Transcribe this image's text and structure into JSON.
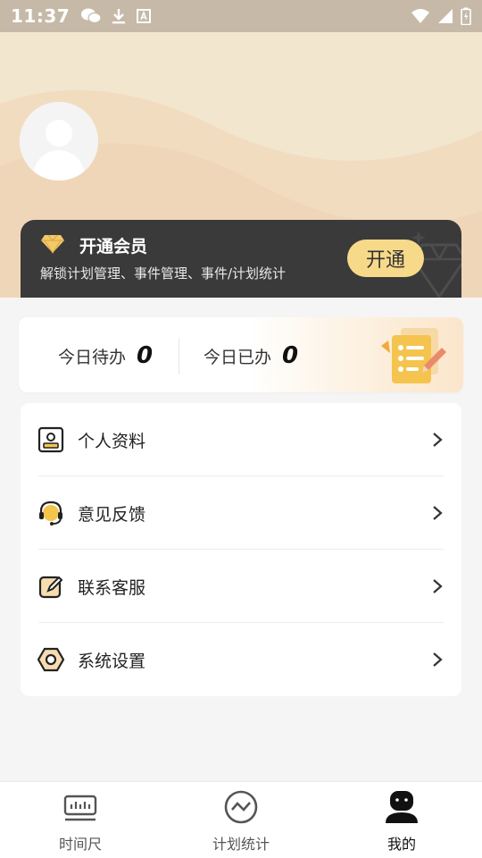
{
  "status_bar": {
    "time": "11:37"
  },
  "profile": {
    "avatar_icon": "default-avatar-icon"
  },
  "vip": {
    "title": "开通会员",
    "description": "解锁计划管理、事件管理、事件/计划统计",
    "button_label": "开通",
    "accent_color": "#f7d98a"
  },
  "today": {
    "pending_label": "今日待办",
    "pending_count": "0",
    "done_label": "今日已办",
    "done_count": "0"
  },
  "menu": {
    "items": [
      {
        "label": "个人资料",
        "icon": "id-card-icon"
      },
      {
        "label": "意见反馈",
        "icon": "headset-icon"
      },
      {
        "label": "联系客服",
        "icon": "edit-note-icon"
      },
      {
        "label": "系统设置",
        "icon": "settings-hex-icon"
      }
    ]
  },
  "bottom_nav": {
    "items": [
      {
        "label": "时间尺",
        "icon": "ruler-icon",
        "active": false
      },
      {
        "label": "计划统计",
        "icon": "trend-circle-icon",
        "active": false
      },
      {
        "label": "我的",
        "icon": "user-icon",
        "active": true
      }
    ]
  }
}
